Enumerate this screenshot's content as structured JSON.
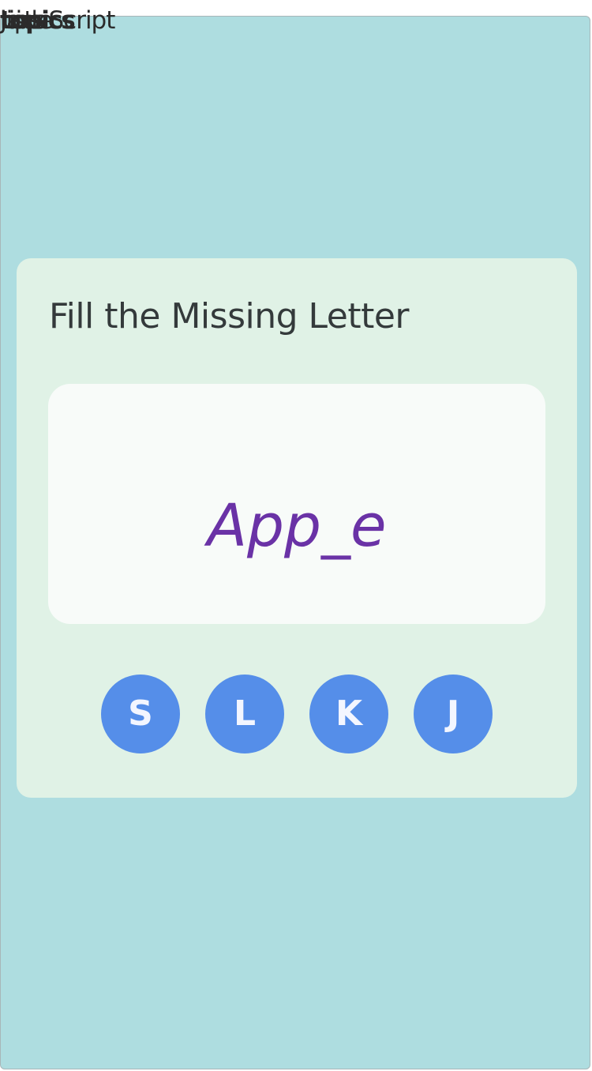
{
  "overlay_texts": [
    "lists",
    "tips",
    "topics",
    "JavaScript",
    "hide"
  ],
  "game": {
    "title": "Fill the Missing Letter",
    "word": "App_e",
    "choices": [
      "S",
      "L",
      "K",
      "J"
    ]
  },
  "colors": {
    "background": "#aedde0",
    "card": "#e0f2e6",
    "word_box": "#f8fbf9",
    "word_text": "#6a32a6",
    "choice_button": "#558ee9"
  }
}
